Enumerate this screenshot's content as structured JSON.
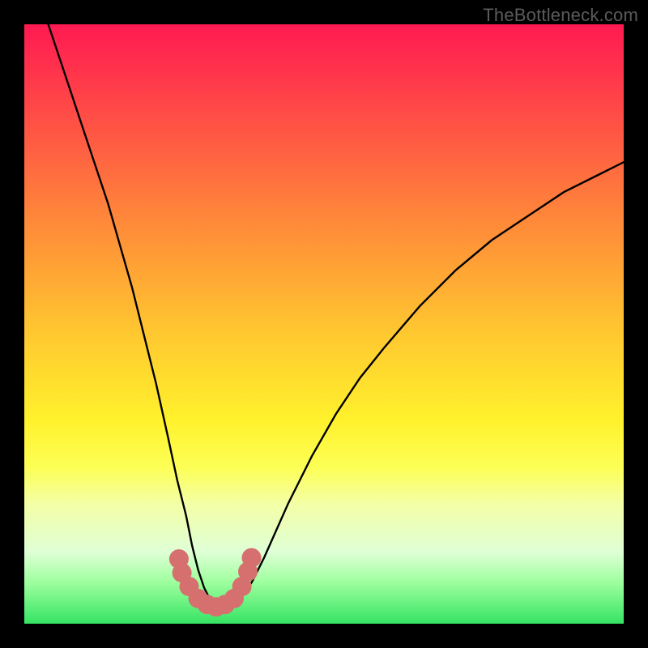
{
  "watermark": "TheBottleneck.com",
  "chart_data": {
    "type": "line",
    "title": "",
    "xlabel": "",
    "ylabel": "",
    "xlim": [
      0,
      100
    ],
    "ylim": [
      0,
      100
    ],
    "series": [
      {
        "name": "bottleneck-curve",
        "x": [
          4,
          6,
          8,
          10,
          12,
          14,
          16,
          18,
          20,
          22,
          24,
          25.5,
          27,
          28,
          29,
          30,
          31,
          32,
          33,
          34,
          35,
          36,
          38,
          40,
          44,
          48,
          52,
          56,
          60,
          66,
          72,
          78,
          84,
          90,
          96,
          100
        ],
        "values": [
          100,
          94,
          88,
          82,
          76,
          70,
          63,
          56,
          48,
          40,
          31,
          24,
          18,
          13,
          9,
          6,
          4,
          3,
          2.5,
          2.5,
          3,
          4,
          7,
          11,
          20,
          28,
          35,
          41,
          46,
          53,
          59,
          64,
          68,
          72,
          75,
          77
        ]
      }
    ],
    "markers": {
      "name": "optimal-range",
      "color": "#d6706e",
      "points": [
        {
          "x": 25.8,
          "y": 10.8
        },
        {
          "x": 26.3,
          "y": 8.5
        },
        {
          "x": 27.5,
          "y": 6.2
        },
        {
          "x": 29.0,
          "y": 4.2
        },
        {
          "x": 30.5,
          "y": 3.2
        },
        {
          "x": 32.0,
          "y": 2.8
        },
        {
          "x": 33.5,
          "y": 3.2
        },
        {
          "x": 35.0,
          "y": 4.2
        },
        {
          "x": 36.3,
          "y": 6.2
        },
        {
          "x": 37.3,
          "y": 8.7
        },
        {
          "x": 37.9,
          "y": 11.0
        }
      ]
    },
    "gradient_stops": [
      {
        "pos": 0,
        "color": "#ff1a52"
      },
      {
        "pos": 25,
        "color": "#ff6e3f"
      },
      {
        "pos": 52,
        "color": "#ffc930"
      },
      {
        "pos": 74,
        "color": "#fdff56"
      },
      {
        "pos": 88,
        "color": "#dfffd6"
      },
      {
        "pos": 100,
        "color": "#35e463"
      }
    ]
  }
}
